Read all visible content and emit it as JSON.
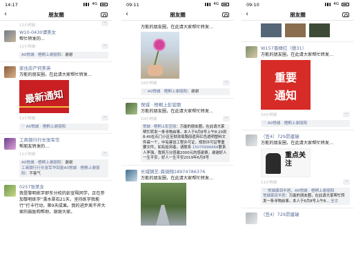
{
  "screens": [
    {
      "status": {
        "time": "14:17",
        "network": "4G"
      },
      "title": "朋友圈",
      "top_meta": "11小时前",
      "posts": [
        {
          "user": "W10-0430谭美女",
          "text": "帮忙转发的…",
          "meta": "11小时前",
          "comment_who": "A0悦城 · 梧桐上谢丽阳",
          "comment": "谢谢"
        },
        {
          "user": "家住房产何美英",
          "text": "万能的朋友圈，在此请大家帮忙转发…",
          "meta": "11小时前",
          "comment_who": "A0悦城 · 梧桐上谢丽阳",
          "comment": "",
          "image_text": "最新通知"
        },
        {
          "user": "工商银行行长张军华",
          "text": "帮朋友转发的…",
          "meta": "11小时前",
          "comment_who": "A0悦城 · 梧桐上谢丽阳",
          "comment": "谢谢",
          "comment2_who": "工商银行行长张军华回复A0悦城 · 梧桐上谢丽阳",
          "comment2": "不客气"
        },
        {
          "user": "0257张美女",
          "text": "我是黎明练字即东分校的彭宣珮同学，正在参加黎明练字“濡水翠石21天，坚持练字我能行”打卡行动，第9天成果。我的进步离不开大家的鼓励和帮助，谢谢大家。"
        }
      ]
    },
    {
      "status": {
        "time": "09:11",
        "network": "4G"
      },
      "title": "朋友圈",
      "posts": [
        {
          "user": "",
          "text": "万能的朋友圈，在此请大家帮忙转发…",
          "meta": "10小时前",
          "comment_who": "A0悦城 · 梧桐上谢丽阳",
          "comment": "谢谢"
        },
        {
          "user": "悦城 · 梧桐上彭宣丽",
          "text": "万能的朋友圈，在此请大家帮忙转发…",
          "meta": "10小时前",
          "reply_who": "悦城 · 梧桐上彭宣丽",
          "reply": "万能的朋友圈，在此请大家帮忙转发一条寻物启事，本人于6月8号上午8:20到8:40在石门小区至财政局路段遗弃红色透明塑料文件袋一个，中有建设工程许可证，规划许可证等重要文件，如有拾到者，请联系",
          "phone": "15070996666",
          "reply_tail": "联系人李强，我将万分感激2000元的感谢费，谢谢好人一生平安，好人一生平安2019年6月8号"
        },
        {
          "user": "长城钢艺-龚骑翔18974786376",
          "text": "万能的朋友圈，在此请大家帮忙转发…",
          "meta": "10小时前"
        }
      ]
    },
    {
      "status": {
        "time": "09:10",
        "network": "4G"
      },
      "title": "朋友圈",
      "posts": [
        {
          "user": "W157晋棣红（德31）",
          "text": "万能的朋友圈，在此请大家帮忙转发…",
          "meta": "10小时前",
          "comment_who": "A0悦城 · 梧桐上谢丽阳",
          "comment": "",
          "image_line1": "重要",
          "image_line2": "通知"
        },
        {
          "user": "（笠4）729昂建瑞",
          "text": "万能的朋友圈，在此请大家帮忙转发…",
          "meta": "11小时前",
          "image_text": "重点关注",
          "likes": "悦城康润半居，A0悦城 · 梧桐上谢丽阳",
          "reply_who": "悦城康润半居",
          "reply": "万能的朋友圈，在此请大家帮忙转发一条寻物启事，本人于6月8号上午8…",
          "reply_more": "全文"
        },
        {
          "user": "（笠4）729昂建瑞",
          "text": "",
          "meta": ""
        }
      ]
    }
  ]
}
